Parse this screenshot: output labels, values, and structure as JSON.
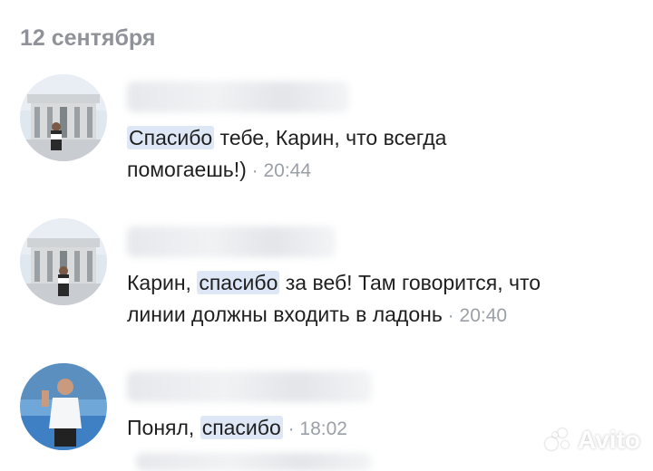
{
  "date_header": "12 сентября",
  "messages": [
    {
      "avatar": "avatar-palace-photo",
      "text_parts": [
        "",
        "Спасибо",
        " тебе, Карин, что всегда"
      ],
      "line2": "помогаешь!)",
      "time": "20:44"
    },
    {
      "avatar": "avatar-palace-photo",
      "text_parts": [
        "Карин, ",
        "спасибо",
        " за веб! Там говорится, что"
      ],
      "line2": "линии должны входить в ладонь",
      "time": "20:40"
    },
    {
      "avatar": "avatar-sport-photo",
      "text_parts": [
        "Понял, ",
        "спасибо",
        ""
      ],
      "time": "18:02"
    }
  ],
  "separator": " · ",
  "watermark": "Avito",
  "colors": {
    "highlight": "#dde7f5",
    "date": "#8f9399",
    "time": "#9aa0a8"
  }
}
